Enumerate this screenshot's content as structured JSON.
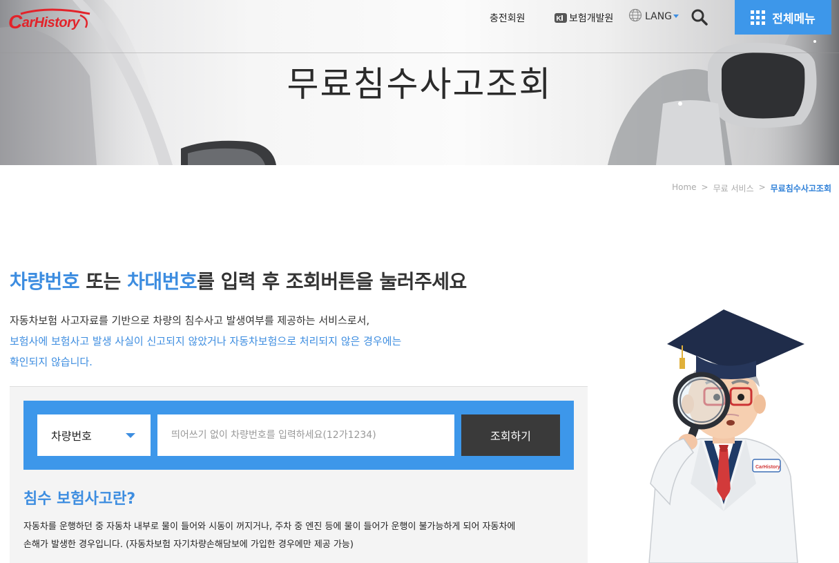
{
  "header": {
    "logo_text_c": "C",
    "logo_text_rest": "arHistory",
    "nav": {
      "member": "충전회원",
      "insurance": "보험개발원",
      "lang": "LANG"
    },
    "icons": {
      "search": "search-icon",
      "globe": "globe-icon",
      "menu": "grid-icon"
    },
    "all_menu_label": "전체메뉴",
    "accent_color": "#3d97ea"
  },
  "hero": {
    "title": "무료침수사고조회"
  },
  "breadcrumb": {
    "items": [
      "Home",
      "무료 서비스"
    ],
    "separator": ">",
    "current": "무료침수사고조회"
  },
  "main": {
    "headline": {
      "part1": "차량번호",
      "part2": " 또는 ",
      "part3": "차대번호",
      "part4": "를 입력 후 조회버튼을 눌러주세요"
    },
    "description": {
      "line1": "자동차보험 사고자료를 기반으로 차량의 침수사고 발생여부를 제공하는 서비스로서,",
      "line2": "보험사에 보험사고 발생 사실이 신고되지 않았거나 자동차보험으로 처리되지 않은 경우에는",
      "line3": "확인되지 않습니다."
    },
    "search": {
      "select_value": "차량번호",
      "placeholder": "띄어쓰기 없이 차량번호를 입력하세요(12가1234)",
      "value": "",
      "submit_label": "조회하기"
    },
    "info": {
      "title": "침수 보험사고란?",
      "body_line1": "자동차를 운행하던 중 자동차 내부로 물이 들어와 시동이 꺼지거나, 주차 중 엔진 등에 물이 들어가 운행이 불가능하게 되어 자동차에",
      "body_line2": "손해가 발생한 경우입니다. (자동차보험 자기차량손해담보에 가입한 경우에만 제공 가능)"
    }
  },
  "mascot": {
    "badge_text": "CarHistory"
  }
}
